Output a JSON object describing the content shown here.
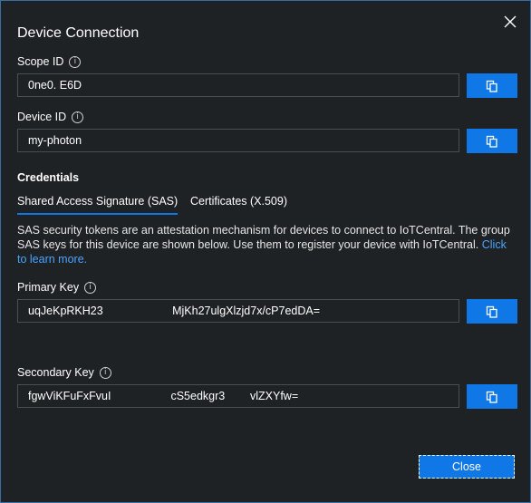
{
  "dialog": {
    "title": "Device Connection",
    "close_icon": "close-icon"
  },
  "scope": {
    "label": "Scope ID",
    "value": "0ne0.   E6D"
  },
  "device": {
    "label": "Device ID",
    "value": "my-photon"
  },
  "credentials": {
    "title": "Credentials",
    "tabs": [
      {
        "label": "Shared Access Signature (SAS)",
        "active": true
      },
      {
        "label": "Certificates (X.509)",
        "active": false
      }
    ],
    "description": "SAS security tokens are an attestation mechanism for devices to connect to IoTCentral. The group SAS keys for this device are shown below. Use them to register your device with IoTCentral. ",
    "link_text": "Click to learn more."
  },
  "primary_key": {
    "label": "Primary Key",
    "value": "uqJeKpRKH23                      MjKh27ulgXlzjd7x/cP7edDA="
  },
  "secondary_key": {
    "label": "Secondary Key",
    "value": "fgwViKFuFxFvuI                   cS5edkgr3        vlZXYfw="
  },
  "footer": {
    "close_label": "Close"
  },
  "colors": {
    "accent": "#0f78e6",
    "background": "#1f2225",
    "link": "#4aa3ff"
  }
}
